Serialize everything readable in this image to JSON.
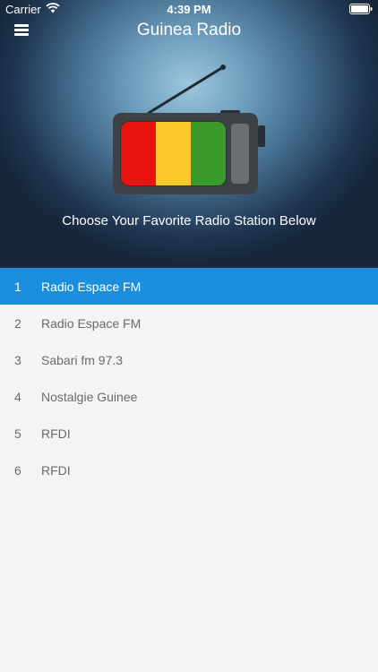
{
  "status_bar": {
    "carrier": "Carrier",
    "time": "4:39 PM",
    "icons": [
      "wifi-icon",
      "battery-icon"
    ]
  },
  "nav": {
    "title": "Guinea Radio",
    "menu_icon": "menu-icon"
  },
  "header": {
    "tagline": "Choose Your Favorite Radio Station Below",
    "flag_colors": [
      "#e8120e",
      "#fcc92b",
      "#3a9b2a"
    ]
  },
  "stations": [
    {
      "number": "1",
      "name": "Radio Espace FM",
      "selected": true
    },
    {
      "number": "2",
      "name": "Radio Espace FM",
      "selected": false
    },
    {
      "number": "3",
      "name": "Sabari fm 97.3",
      "selected": false
    },
    {
      "number": "4",
      "name": "Nostalgie Guinee",
      "selected": false
    },
    {
      "number": "5",
      "name": "RFDI",
      "selected": false
    },
    {
      "number": "6",
      "name": "RFDI",
      "selected": false
    }
  ],
  "colors": {
    "selected_row": "#1b8fdd",
    "list_background": "#f4f4f4",
    "header_dark": "#16273c"
  }
}
